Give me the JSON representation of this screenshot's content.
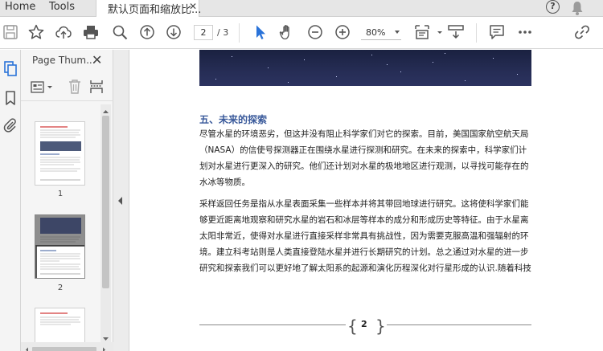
{
  "tabs": {
    "home": "Home",
    "tools": "Tools",
    "document": "默认页面和缩放比..."
  },
  "toolbar": {
    "page_current": "2",
    "page_total": "/ 3",
    "zoom": "80%",
    "icons": [
      "save-icon",
      "bookmark-star-icon",
      "upload-icon",
      "print-icon",
      "search-icon",
      "prev-page-icon",
      "next-page-icon",
      "select-cursor-icon",
      "hand-icon",
      "zoom-out-icon",
      "zoom-in-icon",
      "page-fit-icon",
      "scroll-mode-icon",
      "comment-icon",
      "more-icon",
      "share-icon"
    ]
  },
  "rail": {
    "icons": [
      "thumbnails-icon",
      "bookmark-icon",
      "attachment-icon"
    ]
  },
  "panel": {
    "title": "Page Thum...",
    "thumb_labels": [
      "1",
      "2"
    ]
  },
  "document": {
    "section_title": "五、未来的探索",
    "paragraph1": [
      "尽管水星的环境恶劣，但这并没有阻止科学家们对它的探索。目前，美国国家航空航天局",
      "（NASA）的信使号探测器正在围绕水星进行探测和研究。在未来的探索中，科学家们计",
      "划对水星进行更深入的研究。他们还计划对水星的极地地区进行观测，以寻找可能存在的",
      "水冰等物质。"
    ],
    "paragraph2": [
      "采样返回任务是指从水星表面采集一些样本并将其带回地球进行研究。这将使科学家们能",
      "够更近距离地观察和研究水星的岩石和冰层等样本的成分和形成历史等特征。由于水星离",
      "太阳非常近，使得对水星进行直接采样非常具有挑战性，因为需要克服高温和强辐射的环",
      "境。建立科考站则是人类直接登陆水星并进行长期研究的计划。总之通过对水星的进一步",
      "研究和探索我们可以更好地了解太阳系的起源和演化历程深化对行星形成的认识.随着科技"
    ],
    "page_number": "2"
  }
}
